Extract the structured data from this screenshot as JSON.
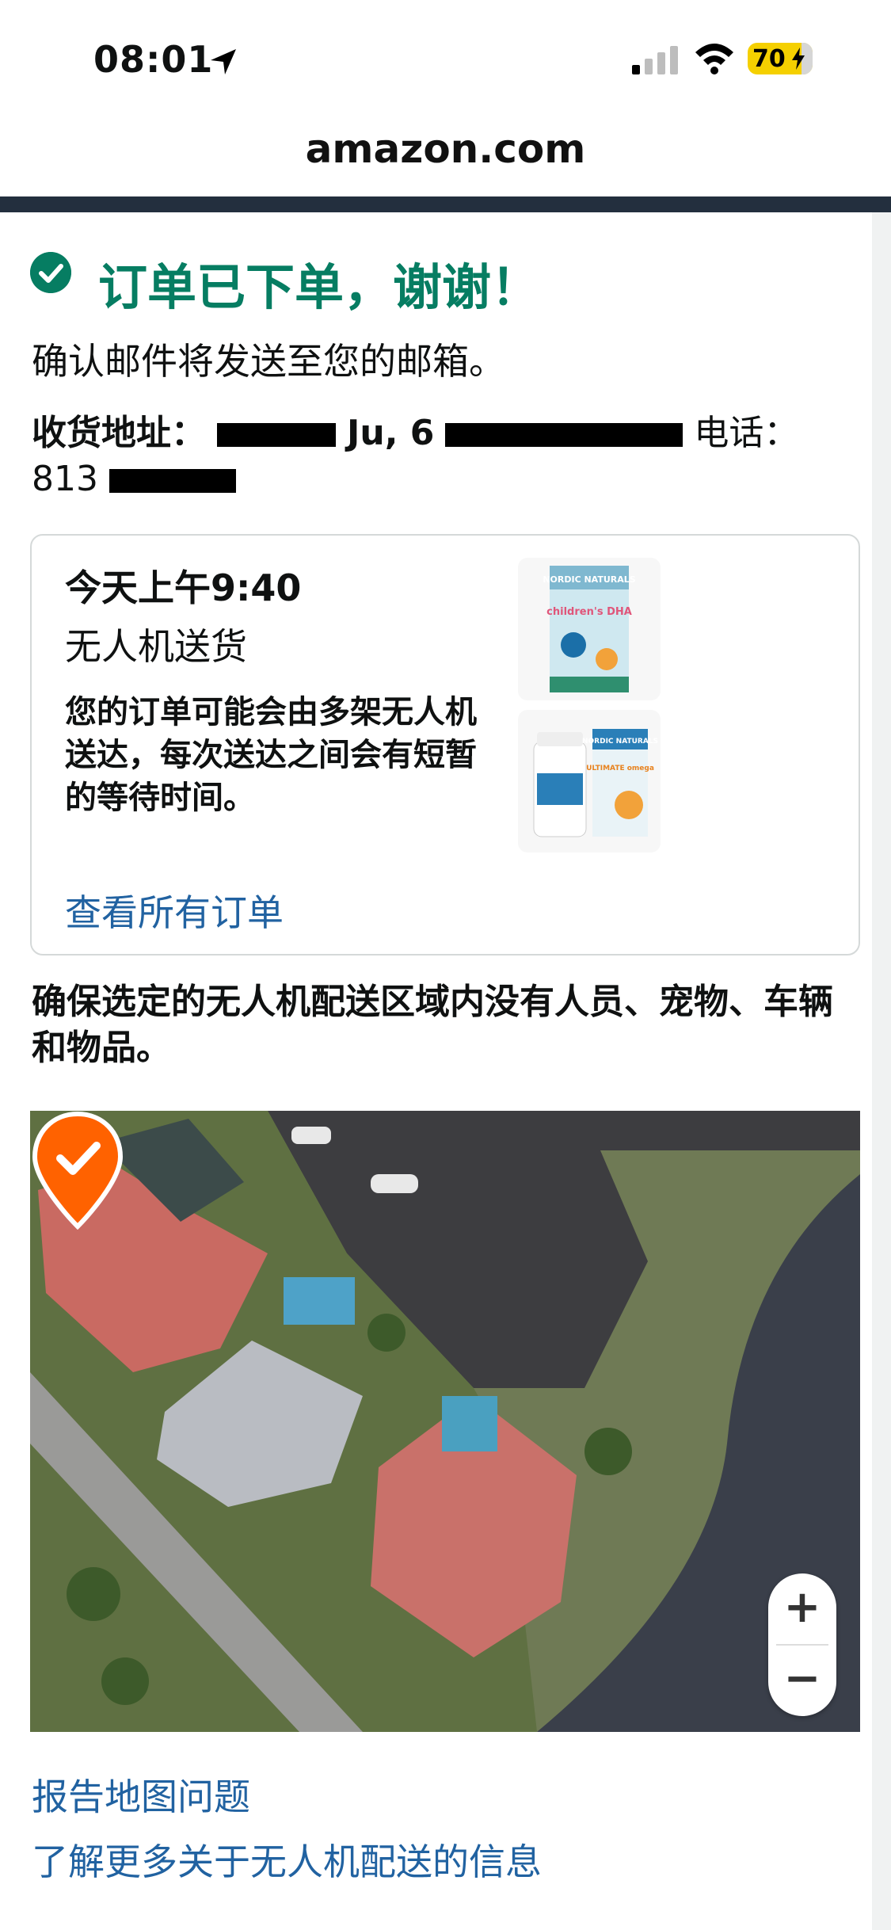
{
  "status_bar": {
    "time": "08:01",
    "battery": "70",
    "icons": [
      "location-arrow-icon",
      "cellular-signal-icon",
      "wifi-icon",
      "battery-charging-icon"
    ]
  },
  "browser": {
    "url": "amazon.com"
  },
  "confirmation": {
    "title": "订单已下单，谢谢！",
    "email_note": "确认邮件将发送至您的邮箱。",
    "address_label": "收货地址：",
    "address_visible": "Ju, 6",
    "phone_label": "电话：",
    "phone_visible": "813"
  },
  "delivery_card": {
    "time": "今天上午9:40",
    "method": "无人机送货",
    "note": "您的订单可能会由多架无人机送达，每次送达之间会有短暂的等待时间。",
    "view_orders_link": "查看所有订单",
    "products": [
      {
        "brand": "NORDIC NATURALS",
        "name": "children's DHA"
      },
      {
        "brand": "NORDIC NATURALS",
        "name": "ULTIMATE omega"
      }
    ]
  },
  "safety_note": "确保选定的无人机配送区域内没有人员、宠物、车辆和物品。",
  "map": {
    "zoom_in_label": "+",
    "zoom_out_label": "−"
  },
  "links": {
    "report_map": "报告地图问题",
    "learn_more": "了解更多关于无人机配送的信息"
  },
  "colors": {
    "success_green": "#067d62",
    "link_blue": "#2162a1",
    "nav_dark": "#232f3e",
    "pin_orange": "#ff6200"
  }
}
